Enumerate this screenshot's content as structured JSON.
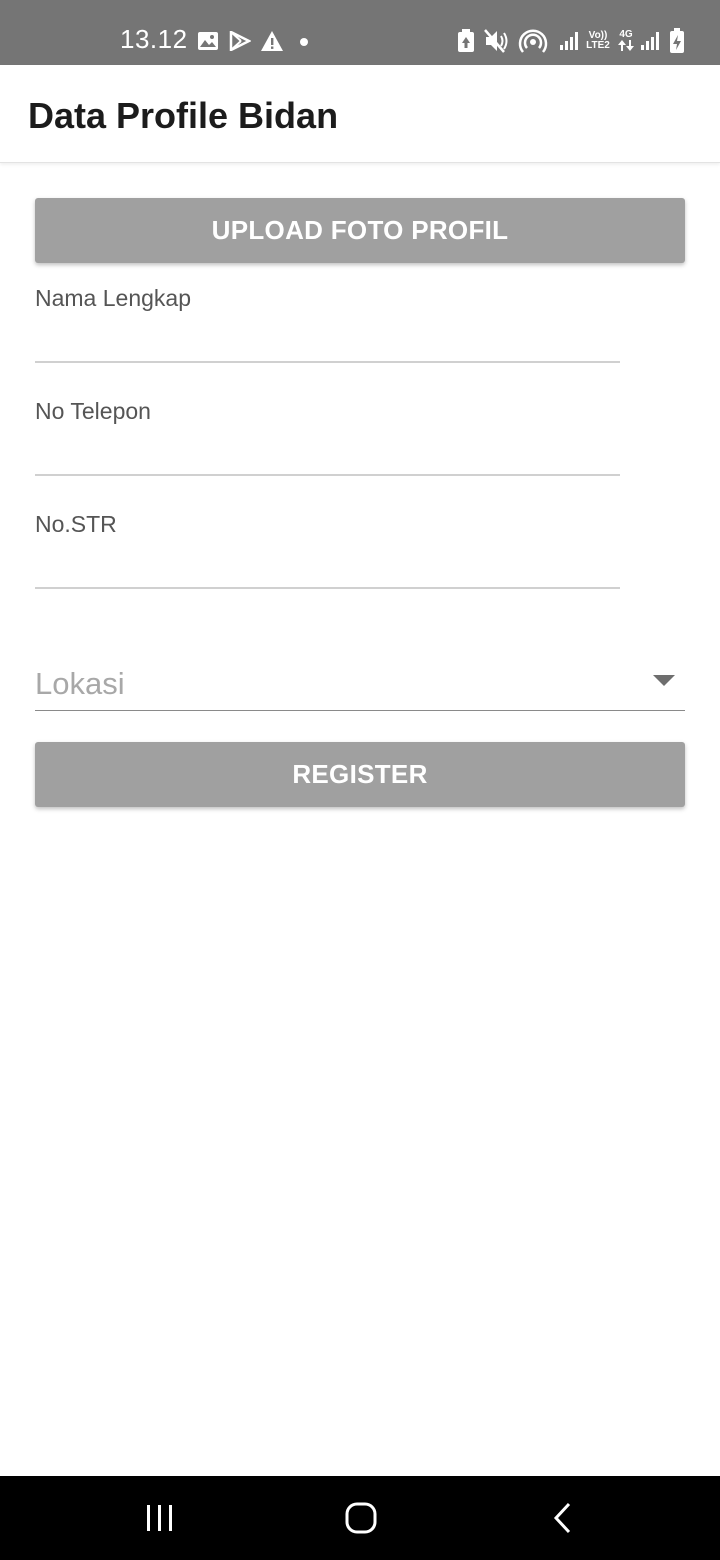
{
  "status_bar": {
    "time": "13.12",
    "left_icons": [
      "gallery-icon",
      "play-store-icon",
      "warning-icon",
      "dot-icon"
    ],
    "right_icons": [
      "battery-saver-icon",
      "mute-icon",
      "hotspot-icon",
      "signal-icon",
      "volte-icon",
      "4g-icon",
      "signal-icon-2",
      "battery-charging-icon"
    ],
    "volte_text_top": "Vo))",
    "volte_text_bottom": "LTE2",
    "network_text": "4G"
  },
  "app_bar": {
    "title": "Data Profile Bidan"
  },
  "form": {
    "upload_button": "UPLOAD FOTO PROFIL",
    "fields": [
      {
        "label": "Nama Lengkap",
        "value": ""
      },
      {
        "label": "No Telepon",
        "value": ""
      },
      {
        "label": "No.STR",
        "value": ""
      }
    ],
    "location_placeholder": "Lokasi",
    "register_button": "REGISTER"
  },
  "nav_bar": {
    "buttons": [
      "recent-apps-icon",
      "home-icon",
      "back-icon"
    ]
  },
  "colors": {
    "status_bar": "#757575",
    "button": "#a0a0a0",
    "nav_bar": "#000000"
  }
}
